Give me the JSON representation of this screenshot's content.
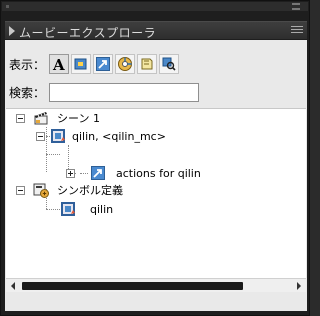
{
  "panel": {
    "title": "ムービーエクスプローラ",
    "show_label": "表示：",
    "search_label": "検索：",
    "search_value": "",
    "toolbar_icons": [
      "text-icon",
      "button-icon",
      "actionscript-icon",
      "video-sound-bitmap-icon",
      "frames-icon",
      "customize-icon"
    ]
  },
  "tree": {
    "scene_label": "シーン 1",
    "instance_label": "qilin, <qilin_mc>",
    "actions_label": "actions for qilin",
    "symbols_label": "シンボル定義",
    "symbol_item_label": "qilin"
  },
  "colors": {
    "frame_bg": "#1e1e1e",
    "titlebar_bg": "#3a3a3a",
    "panel_bg": "#e9e9e9",
    "tree_bg": "#ffffff",
    "scrollbar_thumb": "#1a1a1a"
  }
}
